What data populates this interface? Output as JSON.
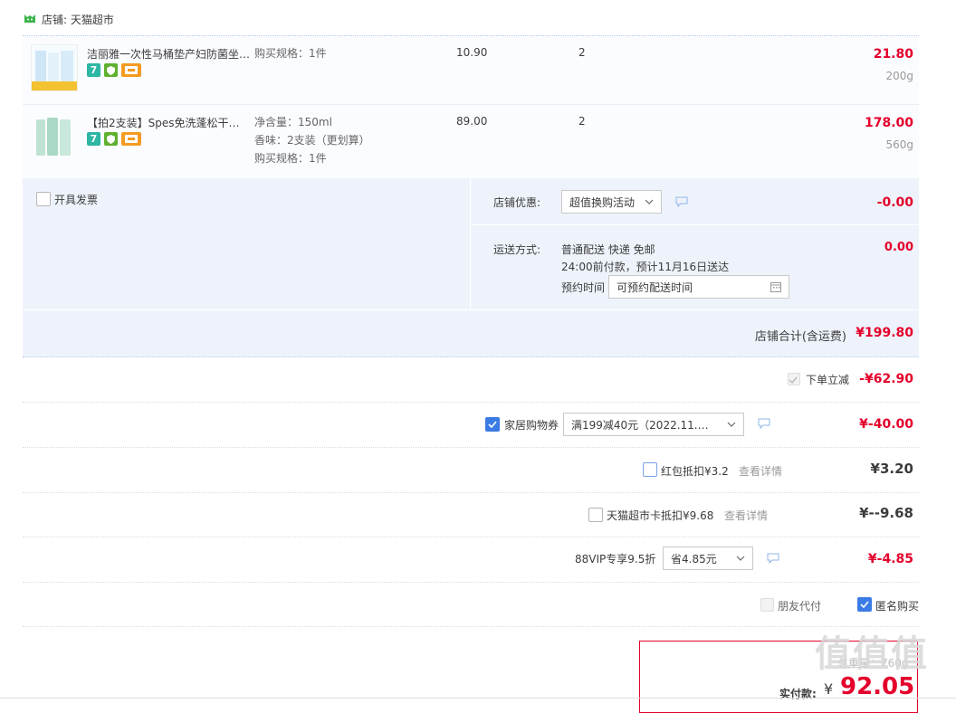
{
  "store": {
    "label": "店铺: 天猫超市"
  },
  "items": [
    {
      "title": "洁丽雅一次性马桶垫产妇防菌坐…",
      "sku": [
        "购买规格：1件"
      ],
      "price": "10.90",
      "qty": "2",
      "subtotal": "21.80",
      "weight": "200g"
    },
    {
      "title": "【拍2支装】Spes免洗蓬松干发…",
      "sku": [
        "净含量：150ml",
        "香味：2支装（更划算）",
        "购买规格：1件"
      ],
      "price": "89.00",
      "qty": "2",
      "subtotal": "178.00",
      "weight": "560g"
    }
  ],
  "badges": {
    "seven": "7"
  },
  "invoice": {
    "label": "开具发票"
  },
  "shop_discount": {
    "label": "店铺优惠:",
    "selected": "超值换购活动",
    "amount": "-0.00"
  },
  "shipping": {
    "label": "运送方式:",
    "line1": "普通配送 快递 免邮",
    "line2": "24:00前付款，预计11月16日送达",
    "appt_label": "预约时间",
    "appt_value": "可预约配送时间",
    "amount": "0.00"
  },
  "store_total": {
    "label": "店铺合计(含运费)",
    "amount": "¥199.80"
  },
  "order_discount": {
    "label": "下单立减",
    "amount": "-¥62.90"
  },
  "home_coupon": {
    "label": "家居购物券",
    "selected": "满199减40元（2022.11.…",
    "amount": "¥-40.00"
  },
  "redpacket": {
    "label": "红包抵扣¥3.2",
    "link": "查看详情",
    "amount": "¥3.20"
  },
  "tmall_card": {
    "label": "天猫超市卡抵扣¥9.68",
    "link": "查看详情",
    "amount": "¥--9.68"
  },
  "vip": {
    "label": "88VIP专享9.5折",
    "selected": "省4.85元",
    "amount": "¥-4.85"
  },
  "friend_pay": {
    "label": "朋友代付"
  },
  "anonymous": {
    "label": "匿名购买"
  },
  "summary": {
    "weight_label": "总重量：760g",
    "pay_label": "实付款:",
    "currency": "¥",
    "pay_amount": "92.05"
  },
  "watermark": "值值值"
}
